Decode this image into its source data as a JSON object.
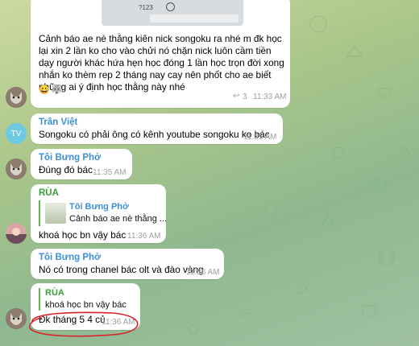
{
  "chat": {
    "top_image": {
      "key_label": "?123",
      "smile_icon": "smile-icon"
    },
    "messages": [
      {
        "text": "Cảnh báo ae nè thằng kiên nick songoku ra nhé m đk học lại xin 2 lần ko cho vào chửi nó chặn nick luôn cầm tiền dạy người khác hứa hẹn học đóng 1 lần học trọn đời  xong nhắn ko thèm rep 2 tháng nay cay nên phốt cho ae biết những ai ý định học thằng này nhé",
        "reactions": [
          "😀",
          "🐺"
        ],
        "replies": "3",
        "time": "11:33 AM"
      },
      {
        "avatar_text": "TV",
        "sender": "Trần Việt",
        "text": "Songoku có phải ông có kênh youtube songoku ko bác",
        "time": "11:35 AM"
      },
      {
        "sender": "Tôi Bưng Phở",
        "text": "Đúng đó bác",
        "time": "11:35 AM"
      },
      {
        "sender": "RÙA",
        "quote_name": "Tôi Bưng Phở",
        "quote_text": "Cảnh báo ae nè thằng ...",
        "text": "khoá học bn vậy bác",
        "time": "11:36 AM"
      },
      {
        "sender": "Tôi Bưng Phở",
        "text": "Nó có trong chanel bác olt và đào vàng",
        "time": "11:36 AM"
      },
      {
        "quote_name": "RÙA",
        "quote_text": "khoá học bn vậy bác",
        "text": "Đk tháng 5 4 củ",
        "time": "11:36 AM"
      }
    ]
  },
  "colors": {
    "name_blue": "#3d8fd6",
    "name_green": "#3a9f3a",
    "avatar_tv": "#6ec9e3",
    "annotation_red": "#d8232a"
  }
}
